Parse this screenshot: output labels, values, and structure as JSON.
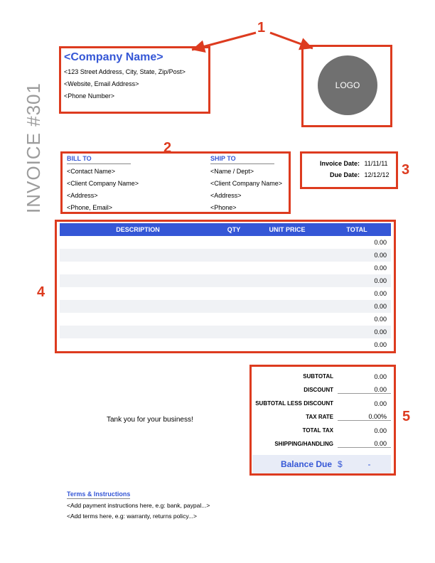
{
  "callouts": {
    "n1": "1",
    "n2": "2",
    "n3": "3",
    "n4": "4",
    "n5": "5"
  },
  "company": {
    "name": "<Company Name>",
    "address": "<123 Street Address, City, State, Zip/Post>",
    "web_email": "<Website, Email Address>",
    "phone": "<Phone Number>"
  },
  "logo_text": "LOGO",
  "side_title": "INVOICE #301",
  "bill_to": {
    "header": "BILL TO",
    "contact": "<Contact Name>",
    "company": "<Client Company Name>",
    "address": "<Address>",
    "phone_email": "<Phone, Email>"
  },
  "ship_to": {
    "header": "SHIP TO",
    "name_dept": "<Name / Dept>",
    "company": "<Client Company Name>",
    "address": "<Address>",
    "phone": "<Phone>"
  },
  "dates": {
    "invoice_label": "Invoice Date:",
    "invoice_value": "11/11/11",
    "due_label": "Due Date:",
    "due_value": "12/12/12"
  },
  "table": {
    "headers": {
      "description": "DESCRIPTION",
      "qty": "QTY",
      "unit_price": "UNIT PRICE",
      "total": "TOTAL"
    },
    "rows": [
      {
        "total": "0.00"
      },
      {
        "total": "0.00"
      },
      {
        "total": "0.00"
      },
      {
        "total": "0.00"
      },
      {
        "total": "0.00"
      },
      {
        "total": "0.00"
      },
      {
        "total": "0.00"
      },
      {
        "total": "0.00"
      },
      {
        "total": "0.00"
      }
    ]
  },
  "thank_you": "Tank you for your business!",
  "totals": {
    "subtotal_label": "SUBTOTAL",
    "subtotal_value": "0.00",
    "discount_label": "DISCOUNT",
    "discount_value": "0.00",
    "subtotal_less_label": "SUBTOTAL LESS DISCOUNT",
    "subtotal_less_value": "0.00",
    "tax_rate_label": "TAX RATE",
    "tax_rate_value": "0.00%",
    "total_tax_label": "TOTAL TAX",
    "total_tax_value": "0.00",
    "shipping_label": "SHIPPING/HANDLING",
    "shipping_value": "0.00",
    "balance_label": "Balance Due",
    "balance_currency": "$",
    "balance_value": "-"
  },
  "terms": {
    "header": "Terms & Instructions",
    "payment": "<Add payment instructions here, e.g: bank, paypal...>",
    "other": "<Add terms here, e.g: warranty, returns policy...>"
  }
}
